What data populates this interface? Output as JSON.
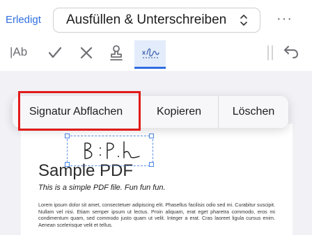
{
  "toolbar": {
    "done_label": "Erledigt",
    "mode_label": "Ausfüllen & Unterschreiben",
    "more_label": "···",
    "text_tool_label": "|Ab"
  },
  "context_menu": {
    "items": [
      {
        "label": "Signatur Abflachen"
      },
      {
        "label": "Kopieren"
      },
      {
        "label": "Löschen"
      }
    ]
  },
  "document": {
    "title": "Sample PDF",
    "subtitle": "This is a simple PDF file. Fun fun fun.",
    "body": "Lorem ipsum dolor sit amet, consectetuer adipiscing elit. Phasellus facilisis odio sed mi. Curabitur suscipit. Nullam vel nisi. Etiam semper ipsum ut lectus. Proin aliquam, erat eget pharetra commodo, eros mi condimentum quam, sed commodo justo quam ut velit. Integer a erat. Cras laoreet ligula cursus enim. Aenean scelerisque velit et tellus."
  },
  "colors": {
    "accent": "#2f6fe0",
    "highlight": "#e21a1a"
  }
}
